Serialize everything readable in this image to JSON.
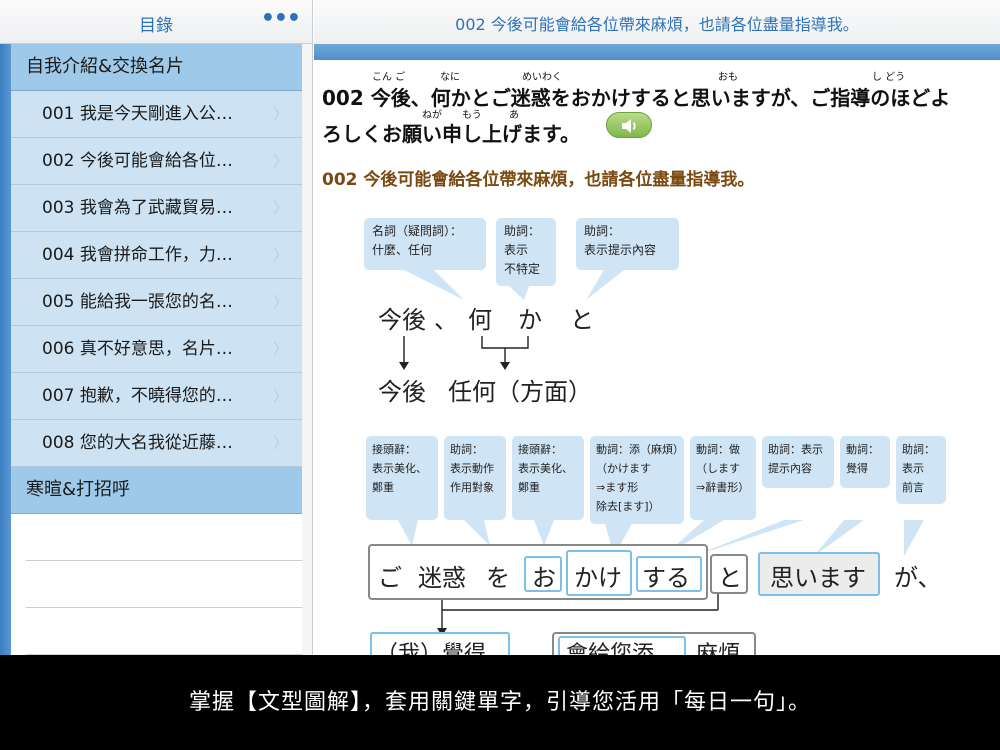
{
  "sidebar": {
    "title": "目錄",
    "more_icon": "more-icon",
    "sections": [
      {
        "label": "自我介紹&交換名片",
        "items": [
          "001 我是今天剛進入公…",
          "002 今後可能會給各位…",
          "003 我會為了武藏貿易…",
          "004 我會拼命工作，力…",
          "005 能給我一張您的名…",
          "006 真不好意思，名片…",
          "007 抱歉，不曉得您的…",
          "008 您的大名我從近藤…"
        ]
      },
      {
        "label": "寒暄&打招呼",
        "items": []
      }
    ]
  },
  "main": {
    "title": "002 今後可能會給各位帶來麻煩，也請各位盡量指導我。",
    "jp_line1": "002 今後、何かとご迷惑をおかけすると思いますが、ご指導のほどよ",
    "jp_line2": "ろしくお願い申し上げます。",
    "furigana": {
      "kongo": "こん ご",
      "nani": "なに",
      "meiwaku": "めいわく",
      "omo": "おも",
      "shidou": "し どう",
      "nega": "ねが",
      "mou": "もう",
      "a": "あ"
    },
    "zh_line": "002 今後可能會給各位帶來麻煩，也請各位盡量指導我。",
    "sound_icon": "speaker-icon"
  },
  "diagram": {
    "top_callouts": [
      "名詞（疑問詞）：\n什麼、任何",
      "助詞：\n表示\n不特定",
      "助詞：\n表示提示內容"
    ],
    "line1": [
      "今後",
      "、",
      "何",
      "か",
      "と"
    ],
    "line2": [
      "今後",
      "任何（方面）"
    ],
    "bottom_callouts": [
      "接頭辭：\n表示美化、\n鄭重",
      "助詞：\n表示動作\n作用對象",
      "接頭辭：\n表示美化、\n鄭重",
      "動詞：添（麻煩）\n（かけます\n⇒ます形\n除去[ます]）",
      "動詞：做\n（します\n⇒辭書形）",
      "助詞：表示\n提示內容",
      "動詞：\n覺得",
      "助詞：\n表示\n前言"
    ],
    "sentence": [
      "ご",
      "迷惑",
      "を",
      "お",
      "かけ",
      "する",
      "と",
      "思います",
      "が、"
    ],
    "bottom_row": [
      "（我）覺得",
      "會給您添",
      "麻煩"
    ]
  },
  "caption": "掌握【文型圖解】，套用關鍵單字，引導您活用「每日一句」。"
}
